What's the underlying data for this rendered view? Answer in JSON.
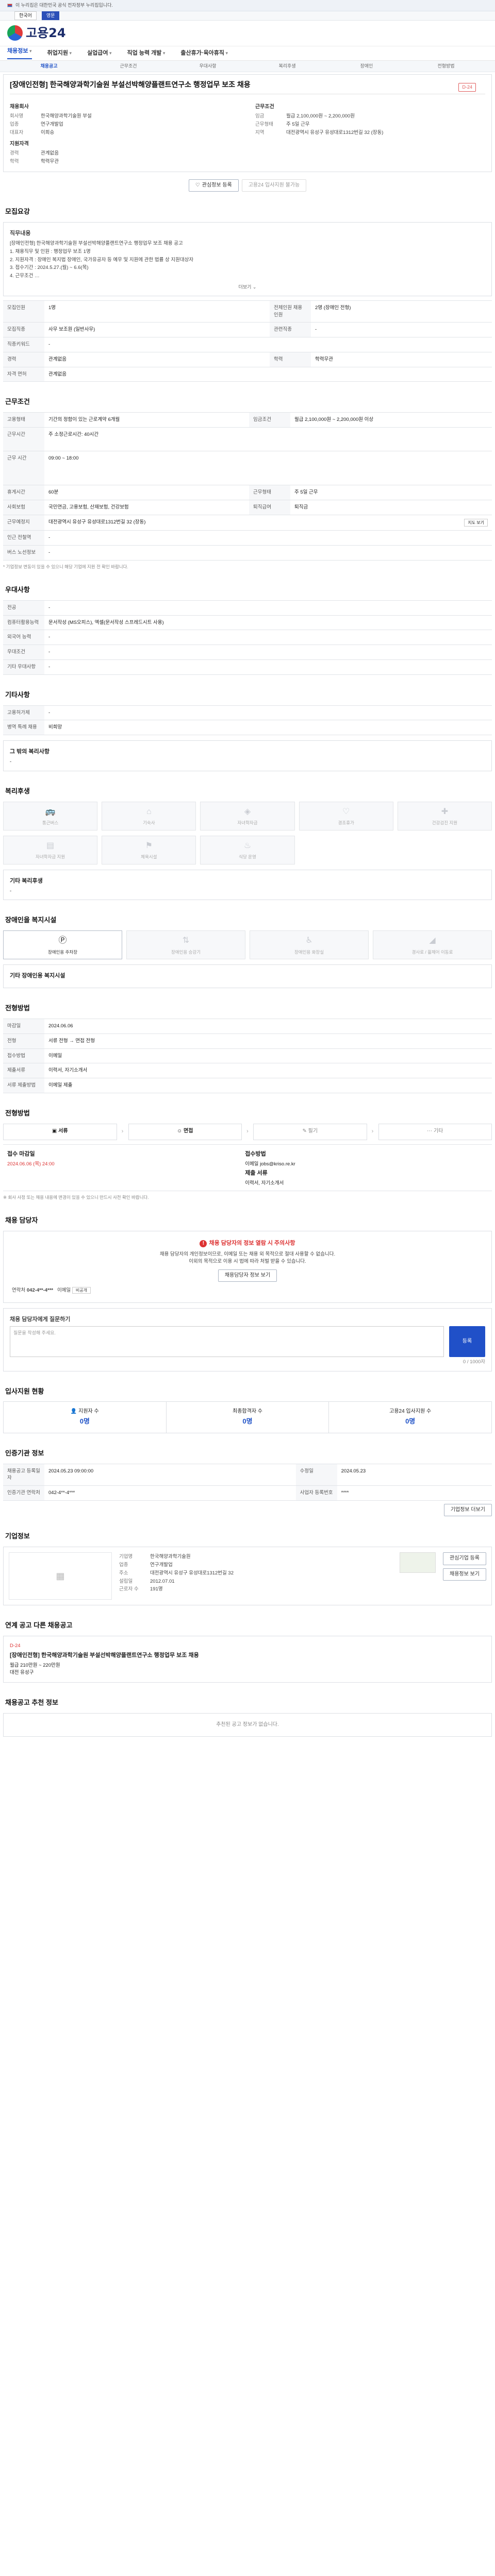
{
  "topbar": {
    "text": "이 누리집은 대한민국 공식 전자정부 누리집입니다."
  },
  "lang": {
    "ko": "한국어",
    "en": "영문"
  },
  "logo": {
    "text": "고용24"
  },
  "nav": [
    "채용정보",
    "취업지원",
    "실업급여",
    "직업 능력 개발",
    "출산휴가·육아휴직"
  ],
  "subtabs": [
    "채용공고",
    "근무조건",
    "우대사항",
    "복리후생",
    "장애인",
    "전형방법"
  ],
  "job": {
    "title": "[장애인전형] 한국해양과학기술원 부설선박해양플랜트연구소 행정업무 보조 채용",
    "dday": "D-24",
    "company_label": "채용회사",
    "company_rows": [
      [
        "회사명",
        "한국해양과학기술원 부설"
      ],
      [
        "업종",
        "연구개발업"
      ],
      [
        "대표자",
        "이희승"
      ]
    ],
    "cond_label": "근무조건",
    "cond_rows": [
      [
        "임금",
        "월급 2,100,000원 ~ 2,200,000원"
      ],
      [
        "근무형태",
        "주 5일 근무"
      ],
      [
        "지역",
        "대전광역시 유성구 유성대로1312번길 32 (장동)"
      ]
    ],
    "req_label": "지원자격",
    "req_rows": [
      [
        "경력",
        "관계없음"
      ],
      [
        "학력",
        "학력무관"
      ]
    ],
    "btn_save": "관심정보 등록",
    "btn_scrap": "고용24 입사지원 불가능"
  },
  "recruit": {
    "title": "모집요강",
    "box_title": "직무내용",
    "lines": [
      "[장애인전형] 한국해양과학기술원 부설선박해양플랜트연구소 행정업무 보조 채용 공고",
      "1. 채용직무 및 인원 : 행정업무 보조 1명",
      "2. 지원자격 : 장애인 복지법 장애인, 국가유공자 등 예우 및 지원에 관한 법률 상 지원대상자",
      "3. 접수기간 : 2024.5.27.(월) ~ 6.6(목)",
      "4. 근무조건 …"
    ],
    "more": "더보기",
    "rows": [
      [
        "모집인원",
        "1명",
        "전체인원 채용 인원",
        "2명 (장애인 전형)"
      ],
      [
        "모집직종",
        "사무 보조원 (일반사무)",
        "관련직종",
        "-"
      ],
      [
        "직종키워드",
        "-",
        "",
        ""
      ],
      [
        "경력",
        "관계없음",
        "학력",
        "학력무관"
      ],
      [
        "자격 면허",
        "관계없음",
        "",
        ""
      ]
    ]
  },
  "work": {
    "title": "근무조건",
    "rows": [
      [
        "고용형태",
        "기간의 정함이 있는 근로계약 6개월",
        "임금조건",
        "월급 2,100,000원 ~ 2,200,000원 이상"
      ],
      [
        "근무시간",
        "주 소정근로시간: 40시간",
        "",
        ""
      ],
      [
        "근무 시간",
        "09:00 ~ 18:00",
        "",
        ""
      ],
      [
        "휴게시간",
        "60분",
        "근무형태",
        "주 5일 근무"
      ],
      [
        "사회보험",
        "국민연금, 고용보험, 산재보험, 건강보험",
        "퇴직급여",
        "퇴직금"
      ],
      [
        "근무예정지",
        "대전광역시 유성구 유성대로1312번길 32 (장동)",
        "",
        ""
      ],
      [
        "인근 전철역",
        "-",
        "",
        ""
      ],
      [
        "버스 노선정보",
        "-",
        "",
        ""
      ]
    ],
    "map_btn": "지도 보기",
    "note": "* 기업정보 변동이 있을 수 있으니 해당 기업에 지원 전 확인 바랍니다."
  },
  "pref": {
    "title": "우대사항",
    "rows": [
      [
        "전공",
        "-"
      ],
      [
        "컴퓨터활용능력",
        "문서작성 (MS오피스), 엑셀(문서작성 스프레드시트 사용)"
      ],
      [
        "외국어 능력",
        "-"
      ],
      [
        "우대조건",
        "-"
      ],
      [
        "기타 우대사항",
        "-"
      ]
    ]
  },
  "etc": {
    "title": "기타사항",
    "rows": [
      [
        "고용허가제",
        "-"
      ],
      [
        "병역 특례 채용",
        "비희망"
      ]
    ],
    "extra_label": "그 밖의 복리사항",
    "extra_val": "-"
  },
  "welfare": {
    "title": "복리후생",
    "items": [
      "통근버스",
      "기숙사",
      "자녀학자금",
      "경조휴가",
      "건강검진 지원",
      "자녀학자금 지원",
      "체육시설",
      "식당 운영"
    ],
    "box_label": "기타 복리후생",
    "box_val": "-"
  },
  "disabled": {
    "title": "장애인을 복지시설",
    "items": [
      "장애인용 주차장",
      "장애인용 승강기",
      "장애인용 화장실",
      "경사로 / 휠체어 이동로"
    ],
    "box_label": "기타 장애인용 복지시설"
  },
  "process": {
    "title": "전형방법",
    "rows": [
      [
        "마감일",
        "2024.06.06"
      ],
      [
        "전형",
        "서류 전형 → 면접 전형"
      ],
      [
        "접수방법",
        "이메일"
      ],
      [
        "제출서류",
        "이력서, 자기소개서"
      ],
      [
        "서류 제출방법",
        "이메일 제출"
      ]
    ],
    "steps": [
      "서류",
      "면접",
      "필기",
      "기타"
    ]
  },
  "apply": {
    "title": "전형방법",
    "period_label": "접수 마감일",
    "period": "2024.06.06 (목) 24:00",
    "method_label": "접수방법",
    "method": "이메일 jobs@kriso.re.kr",
    "doc_label": "제출 서류",
    "doc": "이력서, 자기소개서",
    "note": "※ 회사 사정 또는 채용 내용에 변경이 있을 수 있으니 반드시 사전 확인 바랍니다."
  },
  "contact": {
    "title": "채용 담당자",
    "warn_title": "채용 담당자의 정보 열람 시 주의사항",
    "warn_l1": "채용 담당자의 개인정보이므로, 이메일 또는 채용 외 목적으로 절대 사용할 수 없습니다.",
    "warn_l2": "이외의 목적으로 이용 시 법에 따라 처벌 받을 수 있습니다.",
    "btn_view": "채용담당자 정보 보기",
    "phone_label": "연락처",
    "phone": "042-4**-4***",
    "fax_label": "이메일",
    "fax": "비공개",
    "ask_label": "채용 담당자에게 질문하기",
    "ask_placeholder": "질문을 작성해 주세요.",
    "ask_btn": "등록",
    "ask_count": "0 / 1000자"
  },
  "status": {
    "title": "입사지원 현황",
    "labels": [
      "지원자 수",
      "최종합격자 수",
      "고용24 입사지원 수"
    ],
    "values": [
      "0명",
      "0명",
      "0명"
    ]
  },
  "company": {
    "title": "인증기관 정보",
    "rows": [
      [
        "채용공고 등록일자",
        "2024.05.23 09:00:00"
      ],
      [
        "수정일",
        "2024.05.23"
      ],
      [
        "인증기관 연락처",
        "042-4**-4***"
      ],
      [
        "사업자 등록번호",
        "****"
      ]
    ],
    "btn_more": "기업정보 더보기"
  },
  "enterprise": {
    "title": "기업정보",
    "rows": [
      [
        "기업명",
        "한국해양과학기술원"
      ],
      [
        "업종",
        "연구개발업"
      ],
      [
        "주소",
        "대전광역시 유성구 유성대로1312번길 32"
      ],
      [
        "설립일",
        "2012.07.01"
      ],
      [
        "근로자 수",
        "191명"
      ]
    ],
    "btn_a": "관심기업 등록",
    "btn_b": "채용정보 보기"
  },
  "related": {
    "title": "연계 공고 다른 채용공고",
    "cards": [
      {
        "dday": "D-24",
        "title": "[장애인전형] 한국해양과학기술원 부설선박해양플랜트연구소 행정업무 보조 채용",
        "pay": "월급 210만원 ~ 220만원",
        "place": "대전 유성구"
      }
    ]
  },
  "recommend": {
    "title": "채용공고 추천 정보",
    "empty": "추천된 공고 정보가 없습니다."
  }
}
